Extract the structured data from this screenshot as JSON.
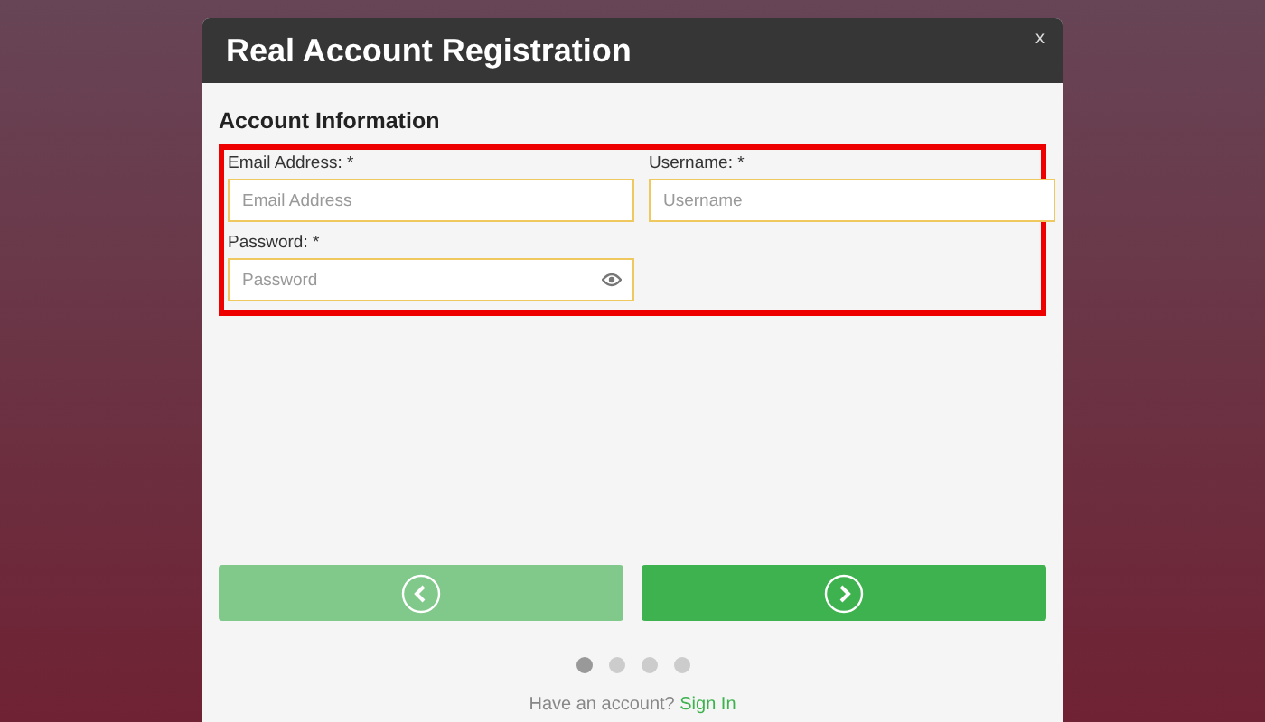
{
  "window": {
    "title": "Real Account Registration",
    "close": "x"
  },
  "section": {
    "title": "Account Information"
  },
  "fields": [
    {
      "label": "Email Address: *",
      "placeholder": "Email Address",
      "kind": "text"
    },
    {
      "label": "Username: *",
      "placeholder": "Username",
      "kind": "text"
    },
    {
      "label": "Password: *",
      "placeholder": "Password",
      "kind": "password"
    }
  ],
  "nav_buttons": [
    {
      "kind": "back",
      "disabled": true
    },
    {
      "kind": "next",
      "disabled": false
    }
  ],
  "steps": [
    {
      "selected": true
    },
    {
      "selected": false
    },
    {
      "selected": false
    },
    {
      "selected": false
    }
  ],
  "footer": {
    "text": "Have an account?",
    "link": "Sign In"
  }
}
